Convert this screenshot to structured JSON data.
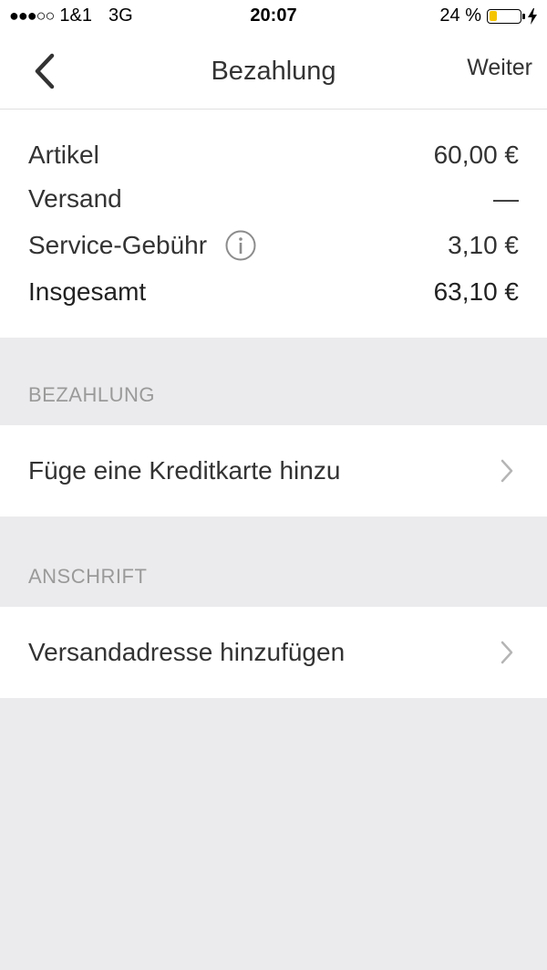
{
  "status_bar": {
    "signal": "●●●○○",
    "carrier": "1&1",
    "network": "3G",
    "time": "20:07",
    "battery_text": "24 %",
    "battery_level": 0.24,
    "battery_color": "#f5c400"
  },
  "nav": {
    "back_icon": "chevron-left-icon",
    "title": "Bezahlung",
    "next_label": "Weiter"
  },
  "summary": {
    "rows": [
      {
        "label": "Artikel",
        "value": "60,00 €"
      },
      {
        "label": "Versand",
        "value": "—"
      },
      {
        "label": "Service-Gebühr",
        "value": "3,10 €",
        "icon": "info-icon"
      },
      {
        "label": "Insgesamt",
        "value": "63,10 €"
      }
    ]
  },
  "sections": {
    "payment": {
      "header": "BEZAHLUNG",
      "item_label": "Füge eine Kreditkarte hinzu"
    },
    "address": {
      "header": "ANSCHRIFT",
      "item_label": "Versandadresse hinzufügen"
    }
  },
  "colors": {
    "background": "#ebebed",
    "text": "#333333",
    "section_header": "#9a9a9a",
    "chevron": "#b5b5b5"
  }
}
